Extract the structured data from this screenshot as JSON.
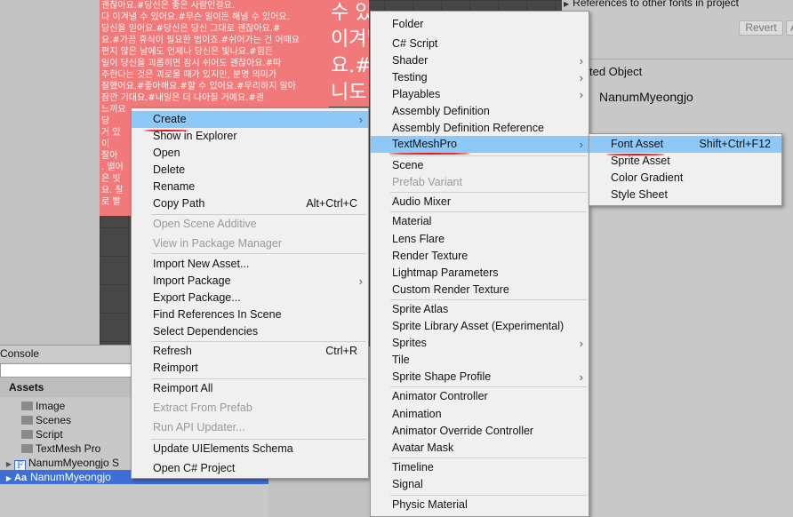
{
  "atlas": {
    "lines": [
      "괜찮아요.#당신은 좋은 사람인걸요.",
      "다 이겨낼 수 있어요.#무슨 일이든 해낼 수 있어요.",
      "당신을 믿어요.#당신은 당신 그대로 괜찮아요.#",
      "요.#가끔 휴식이 필요한 법이죠.#쉬어가는 건 어때요",
      "편지 않은 날에도 언제나 당신은 빛나요.#힘든",
      "일이 당신을 괴롭히면 잠시 쉬어도 괜찮아요.#따",
      "주한다는 것은 괴로울 때가 있지만, 분명 의미가",
      "잘했어요.#좋아해요.#할 수 있어요.#무리하지 말아",
      "잠깐 기대요.#내일은 더 나아질 거예요.#괜",
      "느끼요",
      "당",
      "거 있",
      "이",
      "잘아",
      ". 떨어",
      "은 빗",
      "요. 잘",
      "로 빨"
    ],
    "big_lines": [
      "수 있어요",
      "이겨낼",
      "요.#",
      "니도 ",
      "있어"
    ]
  },
  "inspector": {
    "references_label": "References to other fonts in project",
    "revert_label": "Revert",
    "revert_cut_label": "A",
    "selected_object_label": "ted Object",
    "selected_object_name": "NanumMyeongjo"
  },
  "console": {
    "tab_label": "Console"
  },
  "project": {
    "assets_label": "Assets",
    "items": [
      {
        "label": "Image"
      },
      {
        "label": "Scenes"
      },
      {
        "label": "Script"
      },
      {
        "label": "TextMesh Pro"
      }
    ],
    "font_asset_label": "NanumMyeongjo S",
    "font_source_label": "NanumMyeongjo",
    "font_source_icon": "Aa",
    "font_asset_icon": "F"
  },
  "menu1": {
    "items": [
      {
        "label": "Create",
        "submenu": true,
        "highlighted": true
      },
      {
        "label": "Show in Explorer"
      },
      {
        "label": "Open"
      },
      {
        "label": "Delete"
      },
      {
        "label": "Rename"
      },
      {
        "label": "Copy Path",
        "shortcut": "Alt+Ctrl+C"
      },
      {
        "label": "Open Scene Additive",
        "disabled": true
      },
      {
        "label": "View in Package Manager",
        "disabled": true
      },
      {
        "label": "Import New Asset..."
      },
      {
        "label": "Import Package",
        "submenu": true
      },
      {
        "label": "Export Package..."
      },
      {
        "label": "Find References In Scene"
      },
      {
        "label": "Select Dependencies"
      },
      {
        "label": "Refresh",
        "shortcut": "Ctrl+R"
      },
      {
        "label": "Reimport"
      },
      {
        "label": "Reimport All"
      },
      {
        "label": "Extract From Prefab",
        "disabled": true
      },
      {
        "label": "Run API Updater...",
        "disabled": true
      },
      {
        "label": "Update UIElements Schema"
      },
      {
        "label": "Open C# Project"
      }
    ]
  },
  "menu2": {
    "items": [
      {
        "label": "Folder"
      },
      {
        "label": "C# Script"
      },
      {
        "label": "Shader",
        "submenu": true
      },
      {
        "label": "Testing",
        "submenu": true
      },
      {
        "label": "Playables",
        "submenu": true
      },
      {
        "label": "Assembly Definition"
      },
      {
        "label": "Assembly Definition Reference"
      },
      {
        "label": "TextMeshPro",
        "submenu": true,
        "highlighted": true
      },
      {
        "label": "Scene"
      },
      {
        "label": "Prefab Variant",
        "disabled": true
      },
      {
        "label": "Audio Mixer"
      },
      {
        "label": "Material"
      },
      {
        "label": "Lens Flare"
      },
      {
        "label": "Render Texture"
      },
      {
        "label": "Lightmap Parameters"
      },
      {
        "label": "Custom Render Texture"
      },
      {
        "label": "Sprite Atlas"
      },
      {
        "label": "Sprite Library Asset (Experimental)"
      },
      {
        "label": "Sprites",
        "submenu": true
      },
      {
        "label": "Tile"
      },
      {
        "label": "Sprite Shape Profile",
        "submenu": true
      },
      {
        "label": "Animator Controller"
      },
      {
        "label": "Animation"
      },
      {
        "label": "Animator Override Controller"
      },
      {
        "label": "Avatar Mask"
      },
      {
        "label": "Timeline"
      },
      {
        "label": "Signal"
      },
      {
        "label": "Physic Material"
      }
    ]
  },
  "menu3": {
    "items": [
      {
        "label": "Font Asset",
        "shortcut": "Shift+Ctrl+F12",
        "highlighted": true
      },
      {
        "label": "Sprite Asset"
      },
      {
        "label": "Color Gradient"
      },
      {
        "label": "Style Sheet"
      }
    ]
  },
  "colors": {
    "highlight": "#8ec8f6",
    "annotation_red": "#e11111",
    "atlas_pink": "#f1797a",
    "selection_blue": "#3d6fd6"
  }
}
